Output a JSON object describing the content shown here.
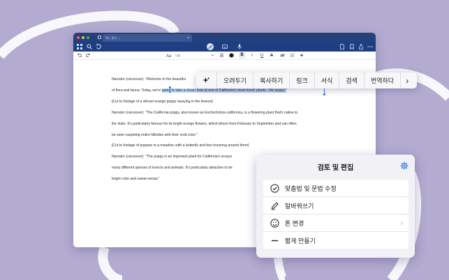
{
  "window": {
    "tab_title": "어느 문서",
    "tab_dropdown": "⌄",
    "tab_close": "×"
  },
  "formatbar": {
    "font_name": "나눔",
    "bold": "B",
    "italic": "I",
    "underline": "U",
    "strike": "S"
  },
  "document": {
    "lines": [
      "Narrator (voiceover): \"Welcome to the beautiful",
      "of flora and fauna. Today, we're ",
      "going to take a closer look at one of California's most iconic plants - the poppy.\"",
      "[Cut to footage of a vibrant orange poppy swaying in the breeze]",
      "Narrator (voiceover): \"The California poppy, also known as Eschscholzia californica, is a flowering plant that's native to",
      "the state. It's particularly famous for its bright orange flowers, which bloom from February to September and can often",
      "be seen carpeting entire hillsides with their vivid color.\"",
      "[Cut to footage of poppies in a meadow, with a butterfly and bee hovering around them]",
      "Narrator (voiceover): \"The poppy is an important plant for California's ecosys",
      "many different species of insects and animals. It's particularly attractive to be",
      "bright color and sweet nectar.\""
    ]
  },
  "context_menu": {
    "items": [
      "오려두기",
      "복사하기",
      "링크",
      "서식",
      "검색",
      "번역하다"
    ],
    "more": "›"
  },
  "panel": {
    "title": "검토 및 편집",
    "options": [
      {
        "label": "맞춤법 및 문법 수정",
        "icon": "check-circle-icon"
      },
      {
        "label": "말바꿔쓰기",
        "icon": "pen-icon"
      },
      {
        "label": "톤 변경",
        "icon": "smiley-icon",
        "chevron": "›"
      },
      {
        "label": "짧게 만들기",
        "icon": "minus-icon"
      }
    ]
  },
  "colors": {
    "background": "#b3abd0",
    "titlebar": "#23407a",
    "menubar": "#1d3e80",
    "selection": "#bcd2f5",
    "selection_handle": "#2f6fe0"
  }
}
